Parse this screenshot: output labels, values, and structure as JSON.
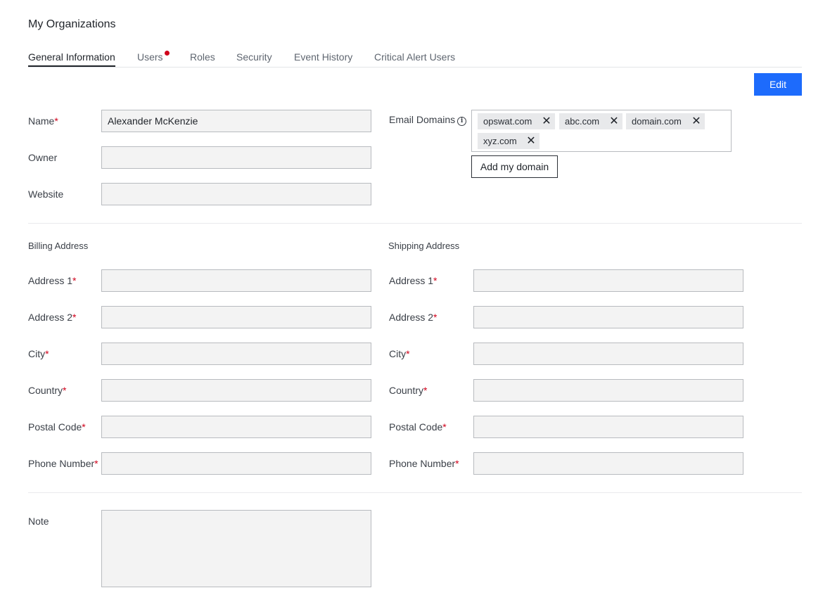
{
  "page_title": "My Organizations",
  "tabs": [
    {
      "label": "General Information"
    },
    {
      "label": "Users"
    },
    {
      "label": "Roles"
    },
    {
      "label": "Security"
    },
    {
      "label": "Event History"
    },
    {
      "label": "Critical Alert Users"
    }
  ],
  "edit_label": "Edit",
  "general": {
    "name_label": "Name",
    "name_value": "Alexander McKenzie",
    "owner_label": "Owner",
    "owner_value": "",
    "website_label": "Website",
    "website_value": "",
    "email_domains_label": "Email Domains",
    "email_domains": [
      "opswat.com",
      "abc.com",
      "domain.com",
      "xyz.com"
    ],
    "add_domain_label": "Add my domain"
  },
  "billing": {
    "title": "Billing Address",
    "fields": [
      {
        "label": "Address 1",
        "value": ""
      },
      {
        "label": "Address 2",
        "value": ""
      },
      {
        "label": "City",
        "value": ""
      },
      {
        "label": "Country",
        "value": ""
      },
      {
        "label": "Postal Code",
        "value": ""
      },
      {
        "label": "Phone Number",
        "value": ""
      }
    ]
  },
  "shipping": {
    "title": "Shipping Address",
    "fields": [
      {
        "label": "Address 1",
        "value": ""
      },
      {
        "label": "Address 2",
        "value": ""
      },
      {
        "label": "City",
        "value": ""
      },
      {
        "label": "Country",
        "value": ""
      },
      {
        "label": "Postal Code",
        "value": ""
      },
      {
        "label": "Phone Number",
        "value": ""
      }
    ]
  },
  "note": {
    "label": "Note",
    "value": ""
  },
  "required_marker": "*",
  "close_glyph": "✕",
  "colors": {
    "accent": "#1d6bfc",
    "required": "#d0021b",
    "notification_dot": "#d0021b"
  }
}
